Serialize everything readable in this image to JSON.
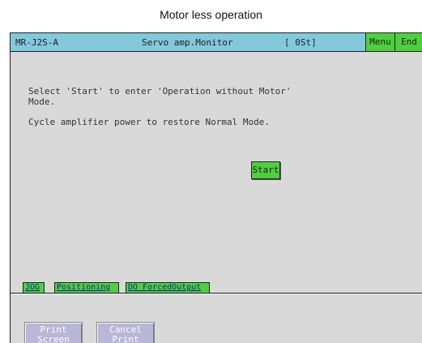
{
  "caption": "Motor less operation",
  "titlebar": {
    "model": "MR-J2S-A",
    "name": "Servo amp.Monitor",
    "status": "[ 0St]",
    "menu_label": "Menu",
    "end_label": "End"
  },
  "message": {
    "line1": "Select 'Start' to enter 'Operation without Motor'",
    "line2": "Mode.",
    "line3": "Cycle amplifier power to restore Normal Mode."
  },
  "start_label": "Start",
  "tabs": [
    {
      "label": "JOG"
    },
    {
      "label": "Positioning"
    },
    {
      "label": "DO ForcedOutput"
    }
  ],
  "bottom_buttons": [
    {
      "line1": "Print",
      "line2": "Screen"
    },
    {
      "line1": "Cancel",
      "line2": "Print"
    }
  ],
  "colors": {
    "titlebar": "#84c8dc",
    "button_green": "#4fcf3f",
    "panel": "#d9d9d9",
    "bottom_button": "#b9b6d8"
  }
}
